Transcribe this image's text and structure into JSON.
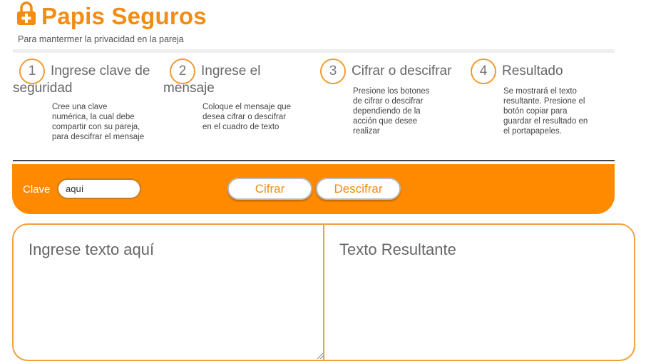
{
  "header": {
    "title": "Papis Seguros",
    "subtitle": "Para mantermer la privacidad en la pareja",
    "logo_icon": "lock-plus-icon",
    "accent_color": "#f28c12"
  },
  "steps": [
    {
      "number": "1",
      "title": "Ingrese clave de seguridad",
      "text": "Cree una clave numérica, la cual debe compartir con su pareja, para descifrar el mensaje"
    },
    {
      "number": "2",
      "title": "Ingrese el mensaje",
      "text": "Coloque el mensaje que desea cifrar o descifrar en el cuadro de texto"
    },
    {
      "number": "3",
      "title": "Cifrar o descifrar",
      "text": "Presione los botones de cifrar o descifrar dependiendo de la acción que desee realizar"
    },
    {
      "number": "4",
      "title": "Resultado",
      "text": "Se mostrará el texto resultante. Presione el botón copiar para guardar el resultado en el portapapeles."
    }
  ],
  "toolbar": {
    "clave_label": "Clave",
    "clave_value": "aquí",
    "cifrar_label": "Cifrar",
    "descifrar_label": "Descifrar",
    "bar_color": "#ff8a00"
  },
  "editor": {
    "input_placeholder": "Ingrese texto aquí",
    "output_placeholder": "Texto Resultante"
  }
}
